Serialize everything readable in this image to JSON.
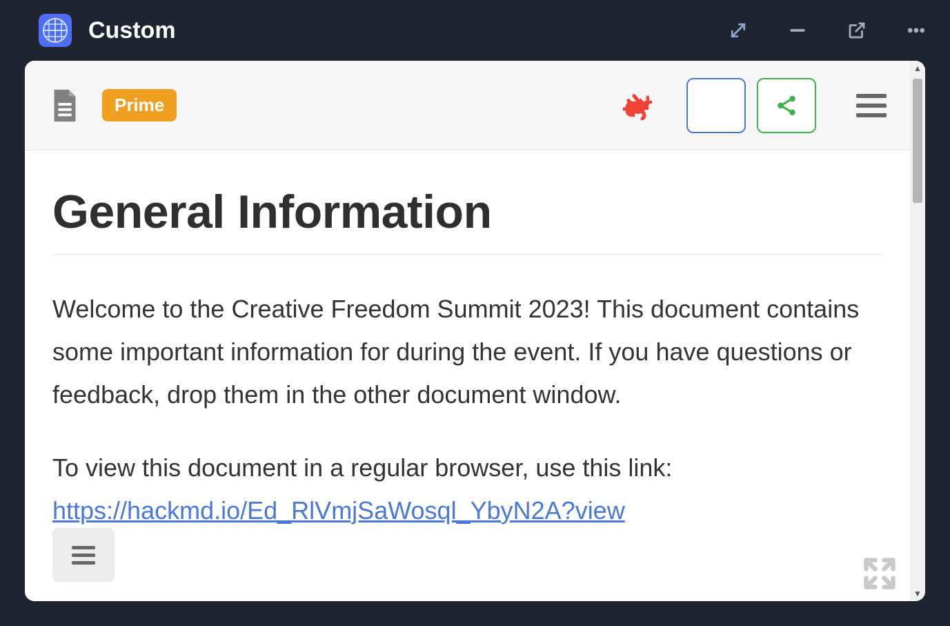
{
  "window": {
    "title": "Custom"
  },
  "header": {
    "prime_badge": "Prime"
  },
  "document": {
    "heading": "General Information",
    "para1": "Welcome to the Creative Freedom Summit 2023! This document contains some important information for during the event. If you have questions or feedback, drop them in the other document window.",
    "para2_prefix": "To view this document in a regular browser, use this link:",
    "link_text": "https://hackmd.io/Ed_RlVmjSaWosql_YbyN2A?view"
  }
}
